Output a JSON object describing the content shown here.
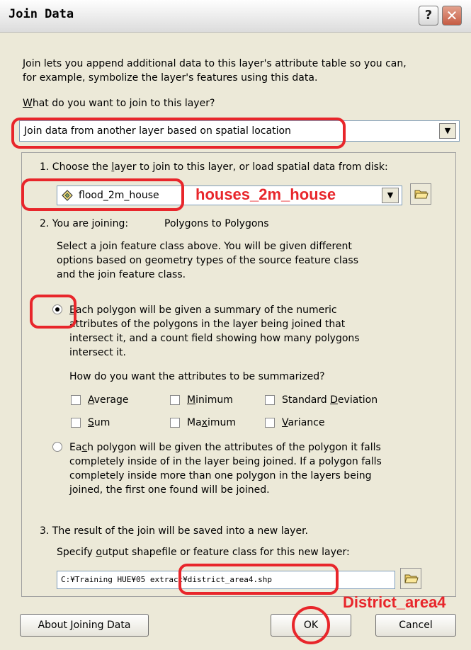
{
  "window": {
    "title": "Join Data",
    "help_glyph": "?",
    "close_glyph": "✕"
  },
  "intro": {
    "line1": "Join lets you append additional data to this layer's attribute table so you can,",
    "line2": "for example, symbolize the layer's features using this data."
  },
  "question": {
    "prefix": "W",
    "rest": "hat do you want to join to this layer?"
  },
  "join_type": {
    "value": "Join data from another layer based on spatial location",
    "arrow": "▼"
  },
  "step1": {
    "pre": "1. Choose the ",
    "underlined": "l",
    "post": "ayer to join to this layer, or load spatial data from disk:",
    "layer": "flood_2m_house",
    "arrow": "▼"
  },
  "step2": {
    "label": "2. You are joining:",
    "value": "Polygons to Polygons",
    "desc": [
      "Select a join feature class above.  You will be given different",
      "options based on geometry types of the source feature class",
      "and the join feature class."
    ]
  },
  "option_summary": {
    "first_letter": "E",
    "first_rest": "ach polygon will be given a summary of the numeric",
    "lines": [
      "attributes of the polygons in the layer being joined that",
      "intersect it, and a count field showing how many polygons",
      "intersect it."
    ],
    "selected": true
  },
  "summarize_question": "How do you want the attributes to be summarized?",
  "checkboxes": [
    {
      "pre": "",
      "u": "A",
      "post": "verage"
    },
    {
      "pre": "",
      "u": "M",
      "post": "inimum"
    },
    {
      "pre": "Standard ",
      "u": "D",
      "post": "eviation"
    },
    {
      "pre": "",
      "u": "S",
      "post": "um"
    },
    {
      "pre": "Ma",
      "u": "x",
      "post": "imum"
    },
    {
      "pre": "",
      "u": "V",
      "post": "ariance"
    }
  ],
  "option_inside": {
    "first_pre": "Ea",
    "first_u": "c",
    "first_rest": "h polygon will be given the attributes of the polygon it falls",
    "lines": [
      "completely inside of in the layer being joined. If a polygon falls",
      "completely inside more than one polygon in the layers being",
      "joined, the first one found will be joined."
    ],
    "selected": false
  },
  "step3": {
    "label": "3. The result of the join will be saved into a new layer.",
    "prompt_pre": "Specify ",
    "prompt_u": "o",
    "prompt_post": "utput shapefile or feature class for this new layer:",
    "path": "C:¥Training HUE¥05 extract¥district_area4.shp"
  },
  "buttons": {
    "about_pre": "About ",
    "about_u": "J",
    "about_post": "oining Data",
    "ok": "OK",
    "cancel": "Cancel"
  },
  "annotations": {
    "layer_name": "houses_2m_house",
    "output_name": "District_area4",
    "color": "#e8262b"
  }
}
